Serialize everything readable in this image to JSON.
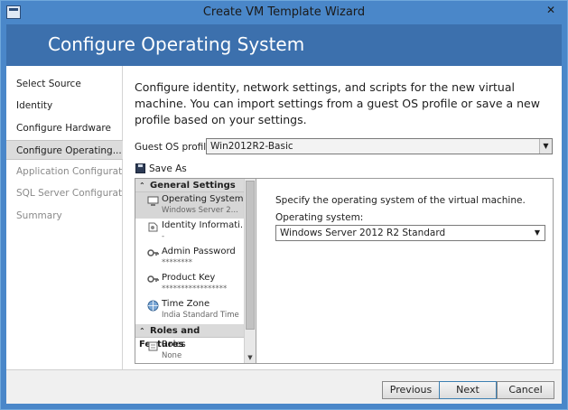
{
  "window": {
    "title": "Create VM Template Wizard",
    "close_symbol": "✕"
  },
  "banner": {
    "heading": "Configure Operating System"
  },
  "nav": {
    "items": [
      {
        "label": "Select Source",
        "state": "normal"
      },
      {
        "label": "Identity",
        "state": "normal"
      },
      {
        "label": "Configure Hardware",
        "state": "normal"
      },
      {
        "label": "Configure Operating...",
        "state": "active"
      },
      {
        "label": "Application Configuration",
        "state": "disabled"
      },
      {
        "label": "SQL Server Configuration",
        "state": "disabled"
      },
      {
        "label": "Summary",
        "state": "disabled"
      }
    ]
  },
  "main": {
    "intro": "Configure identity, network settings, and scripts for the new virtual machine. You can import settings from a guest OS profile or save a new profile based on your settings.",
    "profile_label": "Guest OS profile:",
    "profile_value": "Win2012R2-Basic",
    "save_as_label": "Save As"
  },
  "tree": {
    "general_header": "General Settings",
    "items": [
      {
        "title": "Operating System",
        "subtitle": "Windows Server 2...",
        "icon": "os-icon"
      },
      {
        "title": "Identity Informati...",
        "subtitle": "-",
        "icon": "identity-icon"
      },
      {
        "title": "Admin Password",
        "subtitle": "********",
        "icon": "key-icon"
      },
      {
        "title": "Product Key",
        "subtitle": "*****************",
        "icon": "key-icon"
      },
      {
        "title": "Time Zone",
        "subtitle": "India Standard Time",
        "icon": "globe-icon"
      }
    ],
    "roles_header": "Roles and Features",
    "roles_item": {
      "title": "Roles",
      "subtitle": "None",
      "icon": "roles-icon"
    }
  },
  "detail": {
    "description": "Specify the operating system of the virtual machine.",
    "os_label": "Operating system:",
    "os_value": "Windows Server 2012 R2 Standard"
  },
  "footer": {
    "previous": "Previous",
    "next": "Next",
    "cancel": "Cancel"
  }
}
